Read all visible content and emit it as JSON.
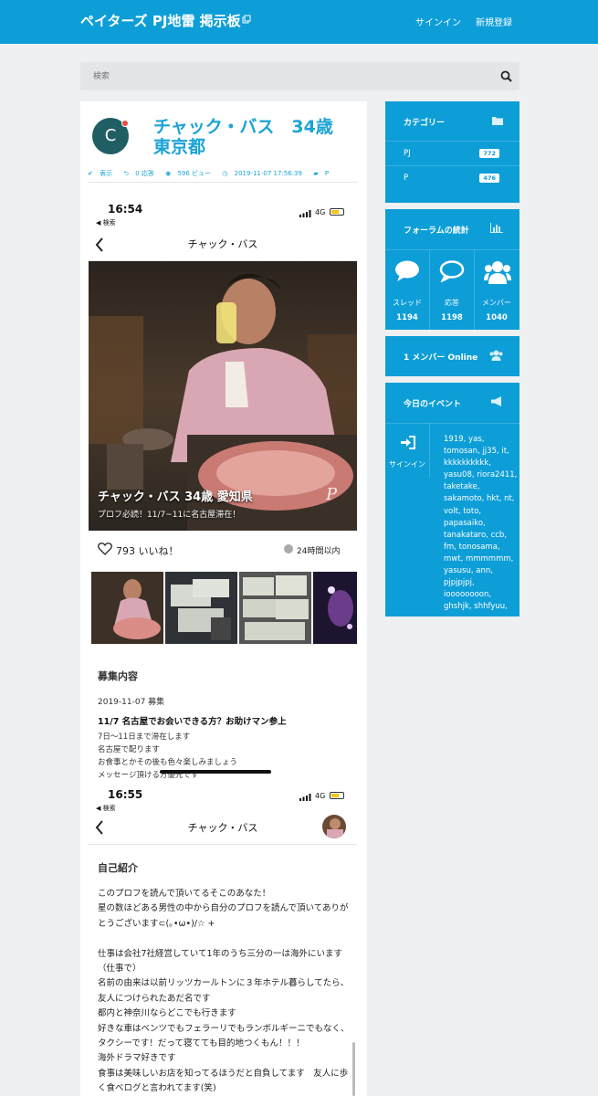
{
  "header": {
    "site_title": "ペイターズ PJ地雷 掲示板",
    "signin": "サインイン",
    "register": "新規登録"
  },
  "search": {
    "placeholder": "検索"
  },
  "post": {
    "avatar_letter": "C",
    "title": "チャック・バス　34歳　東京都",
    "meta": {
      "display": "表示",
      "replies": "0 応答",
      "views": "596 ビュー",
      "date": "2019-11-07 17:56:39",
      "category": "P"
    }
  },
  "screenshot": {
    "time1": "16:54",
    "back_label": "◀ 検索",
    "network": "4G",
    "nav_title": "チャック・バス",
    "photo_caption": "チャック・バス  34歳  愛知県",
    "photo_sub": "プロフ必読！11/7~11に名古屋滞在！",
    "likes": "793 いいね！",
    "online": "24時間以内",
    "section_recruit": "募集内容",
    "recruit_date": "2019-11-07 募集",
    "recruit_title": "11/7 名古屋でお会いできる方？お助けマン参上",
    "recruit_lines": [
      "7日〜11日まで滞在します",
      "名古屋で配ります",
      "お食事とかその後も色々楽しみましょう",
      "メッセージ頂ける方優先です"
    ],
    "time2": "16:55",
    "section_intro": "自己紹介",
    "intro_text": "このプロフを読んで頂いてるそこのあなた！\n星の数ほどある男性の中から自分のプロフを読んで頂いてありがとうございます⊂(｡•ω•)/☆ +\n\n仕事は会社7社経営していて1年のうち三分の一は海外にいます（仕事で）\n名前の由来は以前リッツカールトンに３年ホテル暮らしてたら、友人につけられたあだ名です\n都内と神奈川ならどこでも行きます\n好きな車はベンツでもフェラーリでもランボルギーニでもなく、タクシーです！だって寝てても目的地つくもん！！！\n海外ドラマ好きです\n食事は美味しいお店を知ってるほうだと自負してます　友人に歩く食べログと言われてます(笑)"
  },
  "sidebar": {
    "categories": {
      "title": "カテゴリー",
      "items": [
        {
          "name": "PJ",
          "count": "772"
        },
        {
          "name": "P",
          "count": "476"
        }
      ]
    },
    "stats": {
      "title": "フォーラムの統計",
      "items": [
        {
          "label": "スレッド",
          "value": "1194"
        },
        {
          "label": "応答",
          "value": "1198"
        },
        {
          "label": "メンバー",
          "value": "1040"
        }
      ]
    },
    "online": {
      "title": "1 メンバー Online"
    },
    "events": {
      "title": "今日のイベント",
      "signin_label": "サインイン",
      "users": "1919, yas, tomosan, jj35, it, kkkkkkkkkk, yasu08, riora2411, taketake, sakamoto, hkt, nt, volt, toto, papasaiko, tanakataro, ccb, fm, tonosama, mwt, mmmmmm, yasusu, ann, pjpjpjpj, ioooooooon, ghshjk, shhfyuu,"
    }
  },
  "colors": {
    "accent": "#0d9ed8",
    "title_blue": "#1ba3d6",
    "background": "#eef0f2"
  }
}
